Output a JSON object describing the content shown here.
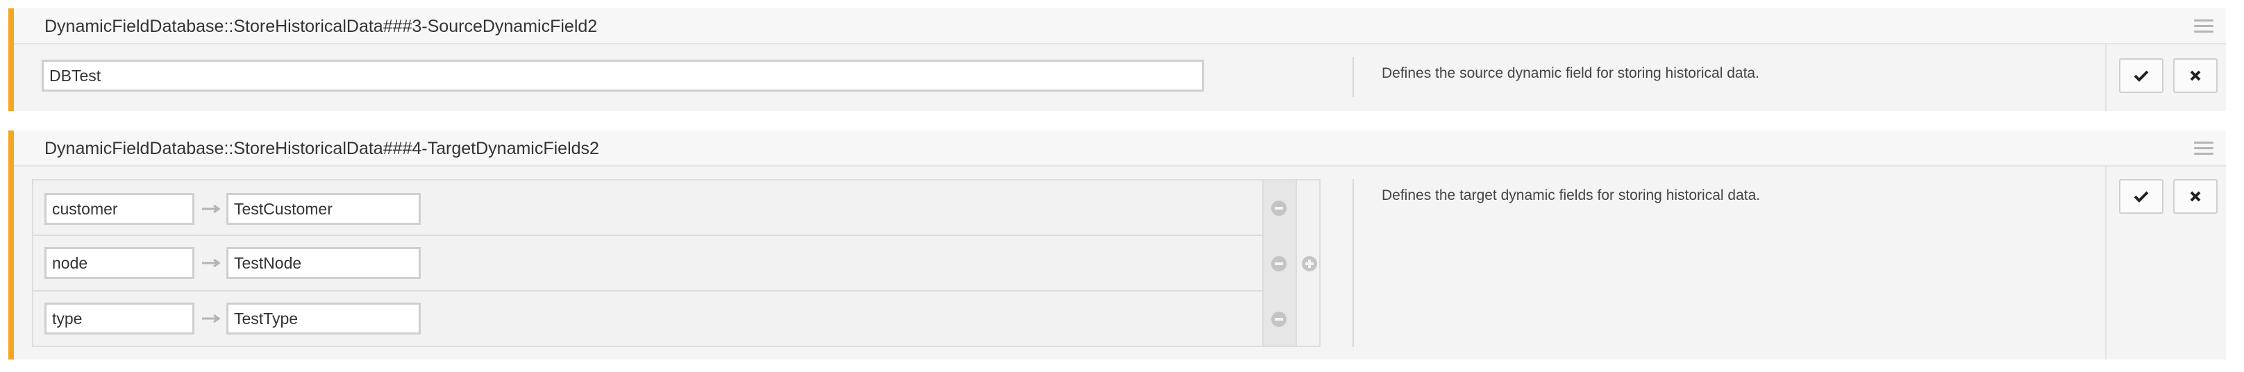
{
  "settings": [
    {
      "title": "DynamicFieldDatabase::StoreHistoricalData###3-SourceDynamicField2",
      "value": "DBTest",
      "description": "Defines the source dynamic field for storing historical data."
    },
    {
      "title": "DynamicFieldDatabase::StoreHistoricalData###4-TargetDynamicFields2",
      "rows": [
        {
          "key": "customer",
          "value": "TestCustomer"
        },
        {
          "key": "node",
          "value": "TestNode"
        },
        {
          "key": "type",
          "value": "TestType"
        }
      ],
      "description": "Defines the target dynamic fields for storing historical data."
    }
  ],
  "icons": {
    "menu": "hamburger-menu-icon",
    "save": "checkmark-icon",
    "cancel": "close-icon",
    "arrow": "right-arrow-icon",
    "remove": "minus-circle-icon",
    "add": "plus-circle-icon"
  },
  "colors": {
    "accent": "#f5a623",
    "panel_bg": "#f4f4f4",
    "border": "#cfcfcf",
    "icon_gray": "#c0c0c0"
  }
}
